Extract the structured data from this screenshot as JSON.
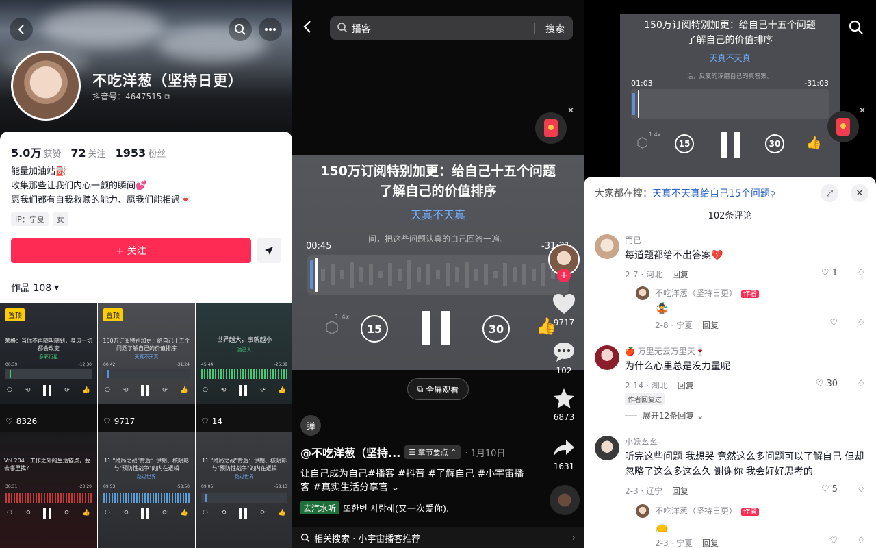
{
  "profile": {
    "nickname": "不吃洋葱（坚持日更）",
    "douyin_id": "抖音号：4647515",
    "stats": [
      {
        "value": "5.0万",
        "label": "获赞"
      },
      {
        "value": "72",
        "label": "关注"
      },
      {
        "value": "1953",
        "label": "粉丝"
      }
    ],
    "bio": [
      "能量加油站⛽",
      "收集那些让我们内心一颤的瞬间💕",
      "愿我们都有自我救赎的能力、愿我们能相遇💌"
    ],
    "tags": [
      "IP：宁夏",
      "女"
    ],
    "follow_label": "+ 关注",
    "works_label": "作品 108",
    "tiles": [
      {
        "pin": "置顶",
        "title": "荣格：当你不再随叫随到，身边一切都会改变",
        "sub": "多彩行星",
        "t1": "00:39",
        "t2": "-12:30",
        "likes": "8326"
      },
      {
        "pin": "置顶",
        "title": "150万订阅特别加更：给自己十五个问题了解自己的价值排序",
        "sub": "天真不天真",
        "t1": "00:42",
        "t2": "-31:24",
        "likes": "9717"
      },
      {
        "pin": "",
        "title": "世界越大，事就越小",
        "sub": "渡己人",
        "t1": "45:44",
        "t2": "-25:38",
        "likes": "14"
      },
      {
        "pin": "",
        "title": "Vol.204｜工作之外的生活锚点，要去哪里找？",
        "sub": "",
        "t1": "30:31",
        "t2": "-23:20",
        "likes": ""
      },
      {
        "pin": "",
        "title": "11 \"终局之战\"背后：伊朗、核阴影与\"预防性战争\"的内在逻辑",
        "sub": "路过世界",
        "t1": "09:53",
        "t2": "-58:50",
        "likes": ""
      },
      {
        "pin": "",
        "title": "11 \"终局之战\"背后：伊朗、核阴影与\"预防性战争\"的内在逻辑",
        "sub": "路过世界",
        "t1": "09:05",
        "t2": "-58:13",
        "likes": ""
      }
    ]
  },
  "player": {
    "search_query": "播客",
    "search_button": "搜索",
    "title_line1": "150万订阅特别加更：给自己十五个问题",
    "title_line2": "了解自己的价值排序",
    "author": "天真不天真",
    "lyric": "间，把这些问题认真的自己回答一遍。",
    "elapsed": "00:45",
    "remaining": "-31:21",
    "speed": "1.4x",
    "skip_back": "15",
    "skip_fwd": "30",
    "likes": "9717",
    "comments": "102",
    "favorites": "6873",
    "shares": "1631",
    "fullscreen": "全屏观看",
    "pro_icon_text": "弹",
    "account": "@不吃洋葱（坚持...",
    "chapter_label": "☰ 章节要点 ^",
    "date": "· 1月10日",
    "description": "让自己成为自己#播客 #抖音 #了解自己 #小宇宙播客 #真实生活分享官 ⌄",
    "music_source": "去汽水听",
    "music_title": "또한번 사랑해(又一次爱你).",
    "related": "相关搜索 · 小宇宙播客推荐",
    "accent_blue": "#6fb0ff",
    "accent_red": "#fe2c55"
  },
  "comments_panel": {
    "mini_title_1": "150万订阅特别加更：给自己十五个问题",
    "mini_title_2": "了解自己的价值排序",
    "mini_author": "天真不天真",
    "mini_lyric": "话，反复的琢磨自己的真答案。",
    "mini_elapsed": "01:03",
    "mini_remaining": "-31:03",
    "hot_prefix": "大家都在搜：",
    "hot_query": "天真不天真给自己15个问题",
    "count": "102条评论",
    "comments": [
      {
        "name": "而已",
        "text": "每道题都给不出答案💔",
        "meta": "2-7 · 河北",
        "reply": "回复",
        "likes": "1"
      },
      {
        "name": "🍎 万里无云万里天🍷",
        "text": "为什么心里总是没力量呢",
        "meta": "2-14 · 湖北",
        "reply": "回复",
        "likes": "30",
        "author_replied": "作者回复过",
        "expand": "展开12条回复 ⌄"
      },
      {
        "name": "小妖幺幺",
        "text": "听完这些问题 我想哭 竟然这么多问题可以了解自己 但却忽略了这么多这么久 谢谢你 我会好好思考的",
        "meta": "2-3 · 辽宁",
        "reply": "回复",
        "likes": "5"
      }
    ],
    "replies": [
      {
        "name": "不吃洋葱（坚持日更）",
        "badge": "作者",
        "emoji": "🤹",
        "meta": "2-8 · 宁夏",
        "reply": "回复"
      },
      {
        "name": "不吃洋葱（坚持日更）",
        "badge": "作者",
        "emoji": "👝",
        "meta": "2-3 · 宁夏",
        "reply": "回复"
      }
    ]
  }
}
